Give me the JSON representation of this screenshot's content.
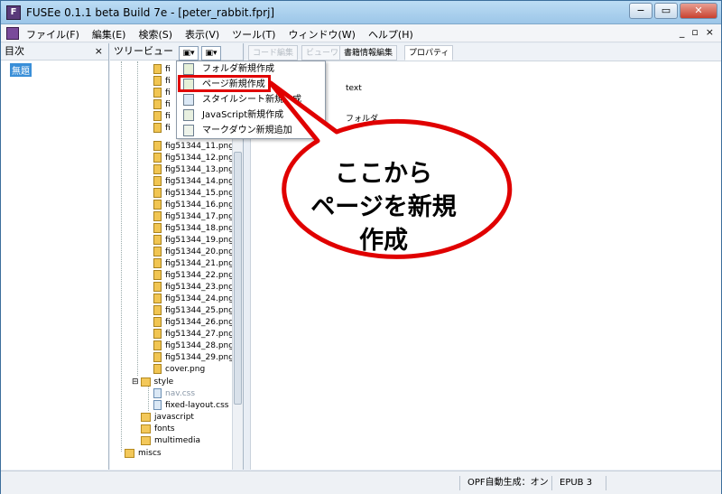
{
  "window": {
    "title": "FUSEe 0.1.1 beta Build 7e - [peter_rabbit.fprj]",
    "app_icon_letter": "F",
    "minimize_label": "−",
    "maximize_label": "▭",
    "close_label": "✕"
  },
  "menubar": {
    "items": [
      "ファイル(F)",
      "編集(E)",
      "検索(S)",
      "表示(V)",
      "ツール(T)",
      "ウィンドウ(W)",
      "ヘルプ(H)"
    ],
    "mdi_min": "_",
    "mdi_restore": "▫",
    "mdi_close": "×"
  },
  "toc": {
    "header": "目次",
    "close": "×",
    "selected_item": "無題"
  },
  "tree": {
    "header": "ツリービュー",
    "fig_partial": [
      "fi",
      "fi",
      "fi",
      "fi",
      "fi",
      "fi"
    ],
    "figs": [
      "fig51344_11.png",
      "fig51344_12.png",
      "fig51344_13.png",
      "fig51344_14.png",
      "fig51344_15.png",
      "fig51344_16.png",
      "fig51344_17.png",
      "fig51344_18.png",
      "fig51344_19.png",
      "fig51344_20.png",
      "fig51344_21.png",
      "fig51344_22.png",
      "fig51344_23.png",
      "fig51344_24.png",
      "fig51344_25.png",
      "fig51344_26.png",
      "fig51344_27.png",
      "fig51344_28.png",
      "fig51344_29.png",
      "cover.png"
    ],
    "style_folder": "style",
    "style_files": [
      "nav.css",
      "fixed-layout.css"
    ],
    "folders": [
      "javascript",
      "fonts",
      "multimedia"
    ],
    "misc_folder": "miscs"
  },
  "tabs": {
    "code_edit": "コード編集",
    "preview": "ビューワ",
    "book_info": "書籍情報編集",
    "properties": "プロパティ"
  },
  "properties": {
    "type_value": "text",
    "folder_value": "フォルダ"
  },
  "dropdown": {
    "items": [
      "フォルダ新規作成",
      "ページ新規作成",
      "スタイルシート新規作成",
      "JavaScript新規作成",
      "マークダウン新規追加"
    ]
  },
  "callout": {
    "line1": "ここから",
    "line2": "ページを新規",
    "line3": "作成"
  },
  "status": {
    "opf": "OPF自動生成：オン",
    "epub": "EPUB 3"
  }
}
